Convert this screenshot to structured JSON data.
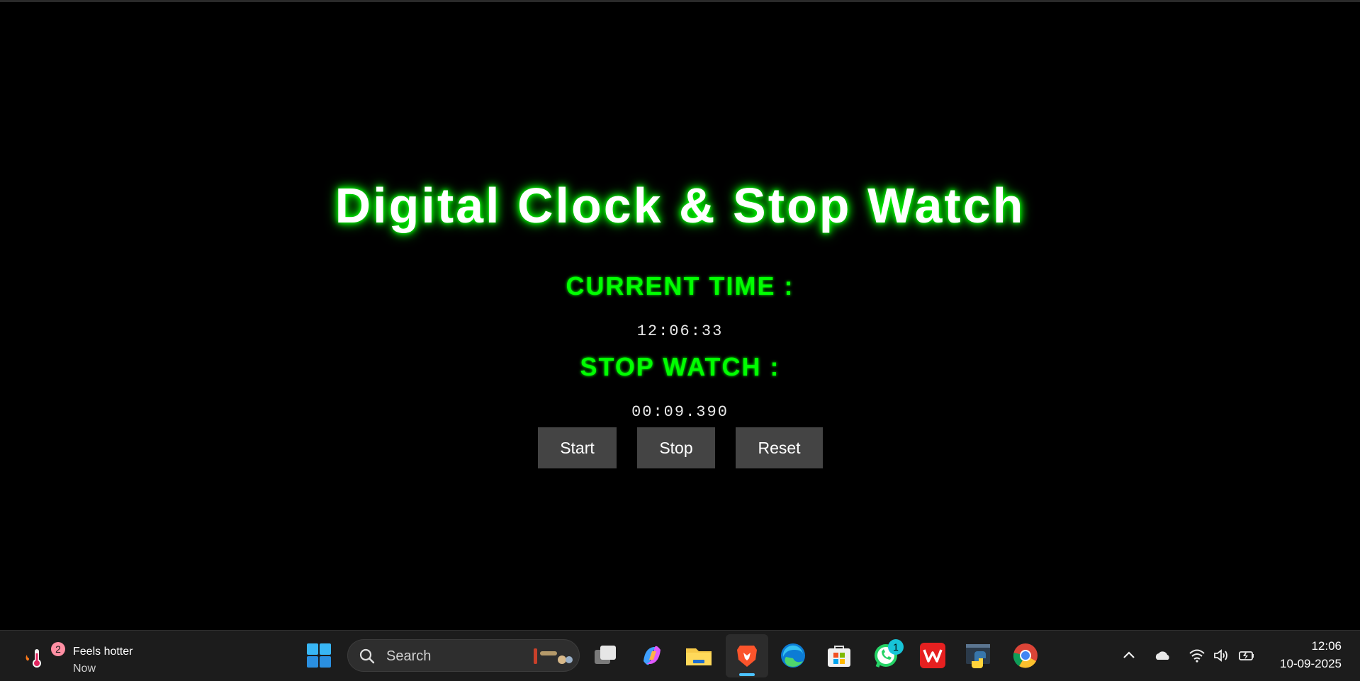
{
  "app": {
    "title": "Digital Clock & Stop Watch",
    "current_time_label": "CURRENT TIME :",
    "current_time_value": "12:06:33",
    "stopwatch_label": "STOP WATCH :",
    "stopwatch_value": "00:09.390",
    "buttons": {
      "start": "Start",
      "stop": "Stop",
      "reset": "Reset"
    },
    "colors": {
      "glow": "#00ff00",
      "background": "#000000",
      "button_bg": "#444444"
    }
  },
  "taskbar": {
    "weather": {
      "title": "Feels hotter",
      "subtitle": "Now",
      "badge": "2",
      "icon": "thermometer-icon"
    },
    "search": {
      "placeholder": "Search",
      "icon": "search-icon"
    },
    "apps": [
      {
        "name": "task-view-icon"
      },
      {
        "name": "copilot-icon"
      },
      {
        "name": "file-explorer-icon"
      },
      {
        "name": "brave-browser-icon",
        "active": true
      },
      {
        "name": "edge-icon"
      },
      {
        "name": "microsoft-store-icon"
      },
      {
        "name": "whatsapp-icon",
        "badge": "1"
      },
      {
        "name": "wps-office-icon"
      },
      {
        "name": "python-icon"
      },
      {
        "name": "chrome-icon"
      }
    ],
    "tray": {
      "icons": [
        "chevron-up-icon",
        "onedrive-icon",
        "wifi-icon",
        "volume-icon",
        "battery-icon"
      ],
      "time": "12:06",
      "date": "10-09-2025"
    }
  }
}
